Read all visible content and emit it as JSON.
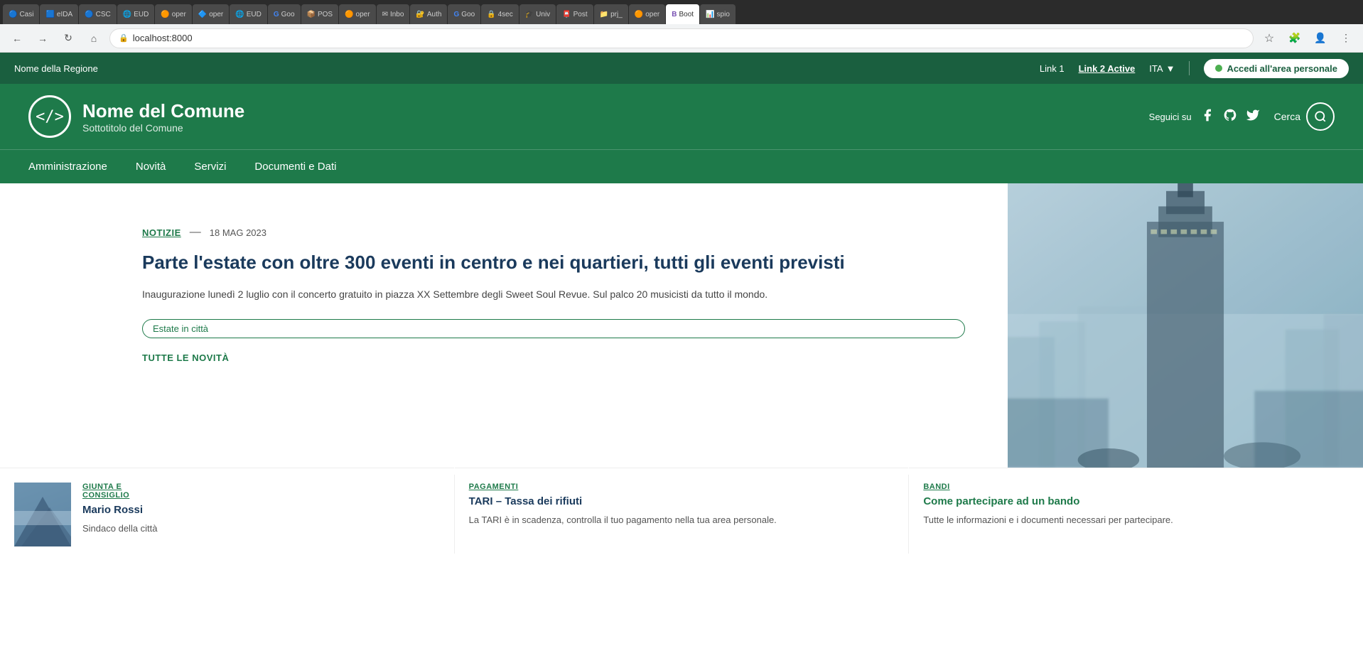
{
  "browser": {
    "address": "localhost:8000",
    "tabs": [
      {
        "label": "Casi",
        "active": false,
        "favicon": "🔵"
      },
      {
        "label": "eIDA",
        "active": false,
        "favicon": "🟦"
      },
      {
        "label": "CSC",
        "active": false,
        "favicon": "🔵"
      },
      {
        "label": "EUD",
        "active": false,
        "favicon": "🌐"
      },
      {
        "label": "oper",
        "active": false,
        "favicon": "🟠"
      },
      {
        "label": "oper",
        "active": false,
        "favicon": "🔷"
      },
      {
        "label": "EUD",
        "active": false,
        "favicon": "🌐"
      },
      {
        "label": "Goo",
        "active": false,
        "favicon": "G"
      },
      {
        "label": "POS",
        "active": false,
        "favicon": "📦"
      },
      {
        "label": "oper",
        "active": false,
        "favicon": "🟠"
      },
      {
        "label": "Inbo",
        "active": false,
        "favicon": "✉"
      },
      {
        "label": "Auth",
        "active": false,
        "favicon": "🔐"
      },
      {
        "label": "Goo",
        "active": false,
        "favicon": "G"
      },
      {
        "label": "4sec",
        "active": false,
        "favicon": "🔒"
      },
      {
        "label": "Univ",
        "active": false,
        "favicon": "🎓"
      },
      {
        "label": "Post",
        "active": false,
        "favicon": "📮"
      },
      {
        "label": "prj_",
        "active": false,
        "favicon": "📁"
      },
      {
        "label": "oper",
        "active": false,
        "favicon": "🟠"
      },
      {
        "label": "Boot",
        "active": true,
        "favicon": "🅱"
      },
      {
        "label": "spio",
        "active": false,
        "favicon": "📊"
      }
    ]
  },
  "topbar": {
    "region_name": "Nome della Regione",
    "link1": "Link 1",
    "link2": "Link 2 Active",
    "lang": "ITA",
    "login_btn": "Accedi all'area personale"
  },
  "header": {
    "logo_code": "</> ",
    "site_title": "Nome del Comune",
    "site_subtitle": "Sottotitolo del Comune",
    "seguici_label": "Seguici su",
    "search_label": "Cerca"
  },
  "nav": {
    "items": [
      {
        "label": "Amministrazione"
      },
      {
        "label": "Novità"
      },
      {
        "label": "Servizi"
      },
      {
        "label": "Documenti e Dati"
      }
    ]
  },
  "hero": {
    "category": "NOTIZIE",
    "separator": "—",
    "date": "18 MAG 2023",
    "title": "Parte l'estate con oltre 300 eventi in centro e nei quartieri, tutti gli eventi previsti",
    "description": "Inaugurazione lunedì 2 luglio con il concerto gratuito in piazza XX Settembre degli Sweet Soul Revue. Sul palco 20 musicisti da tutto il mondo.",
    "tag": "Estate in città",
    "all_news": "TUTTE LE NOVITÀ"
  },
  "cards": [
    {
      "category": "GIUNTA E\nCONSIGLIO",
      "title": "Mario Rossi",
      "desc": "Sindaco della città"
    },
    {
      "category": "PAGAMENTI",
      "title": "TARI – Tassa dei rifiuti",
      "desc": "La TARI è in scadenza, controlla il tuo pagamento nella tua area personale."
    },
    {
      "category": "BANDI",
      "title": "Come partecipare ad un bando",
      "desc": "Tutte le informazioni e i documenti necessari per partecipare."
    }
  ]
}
